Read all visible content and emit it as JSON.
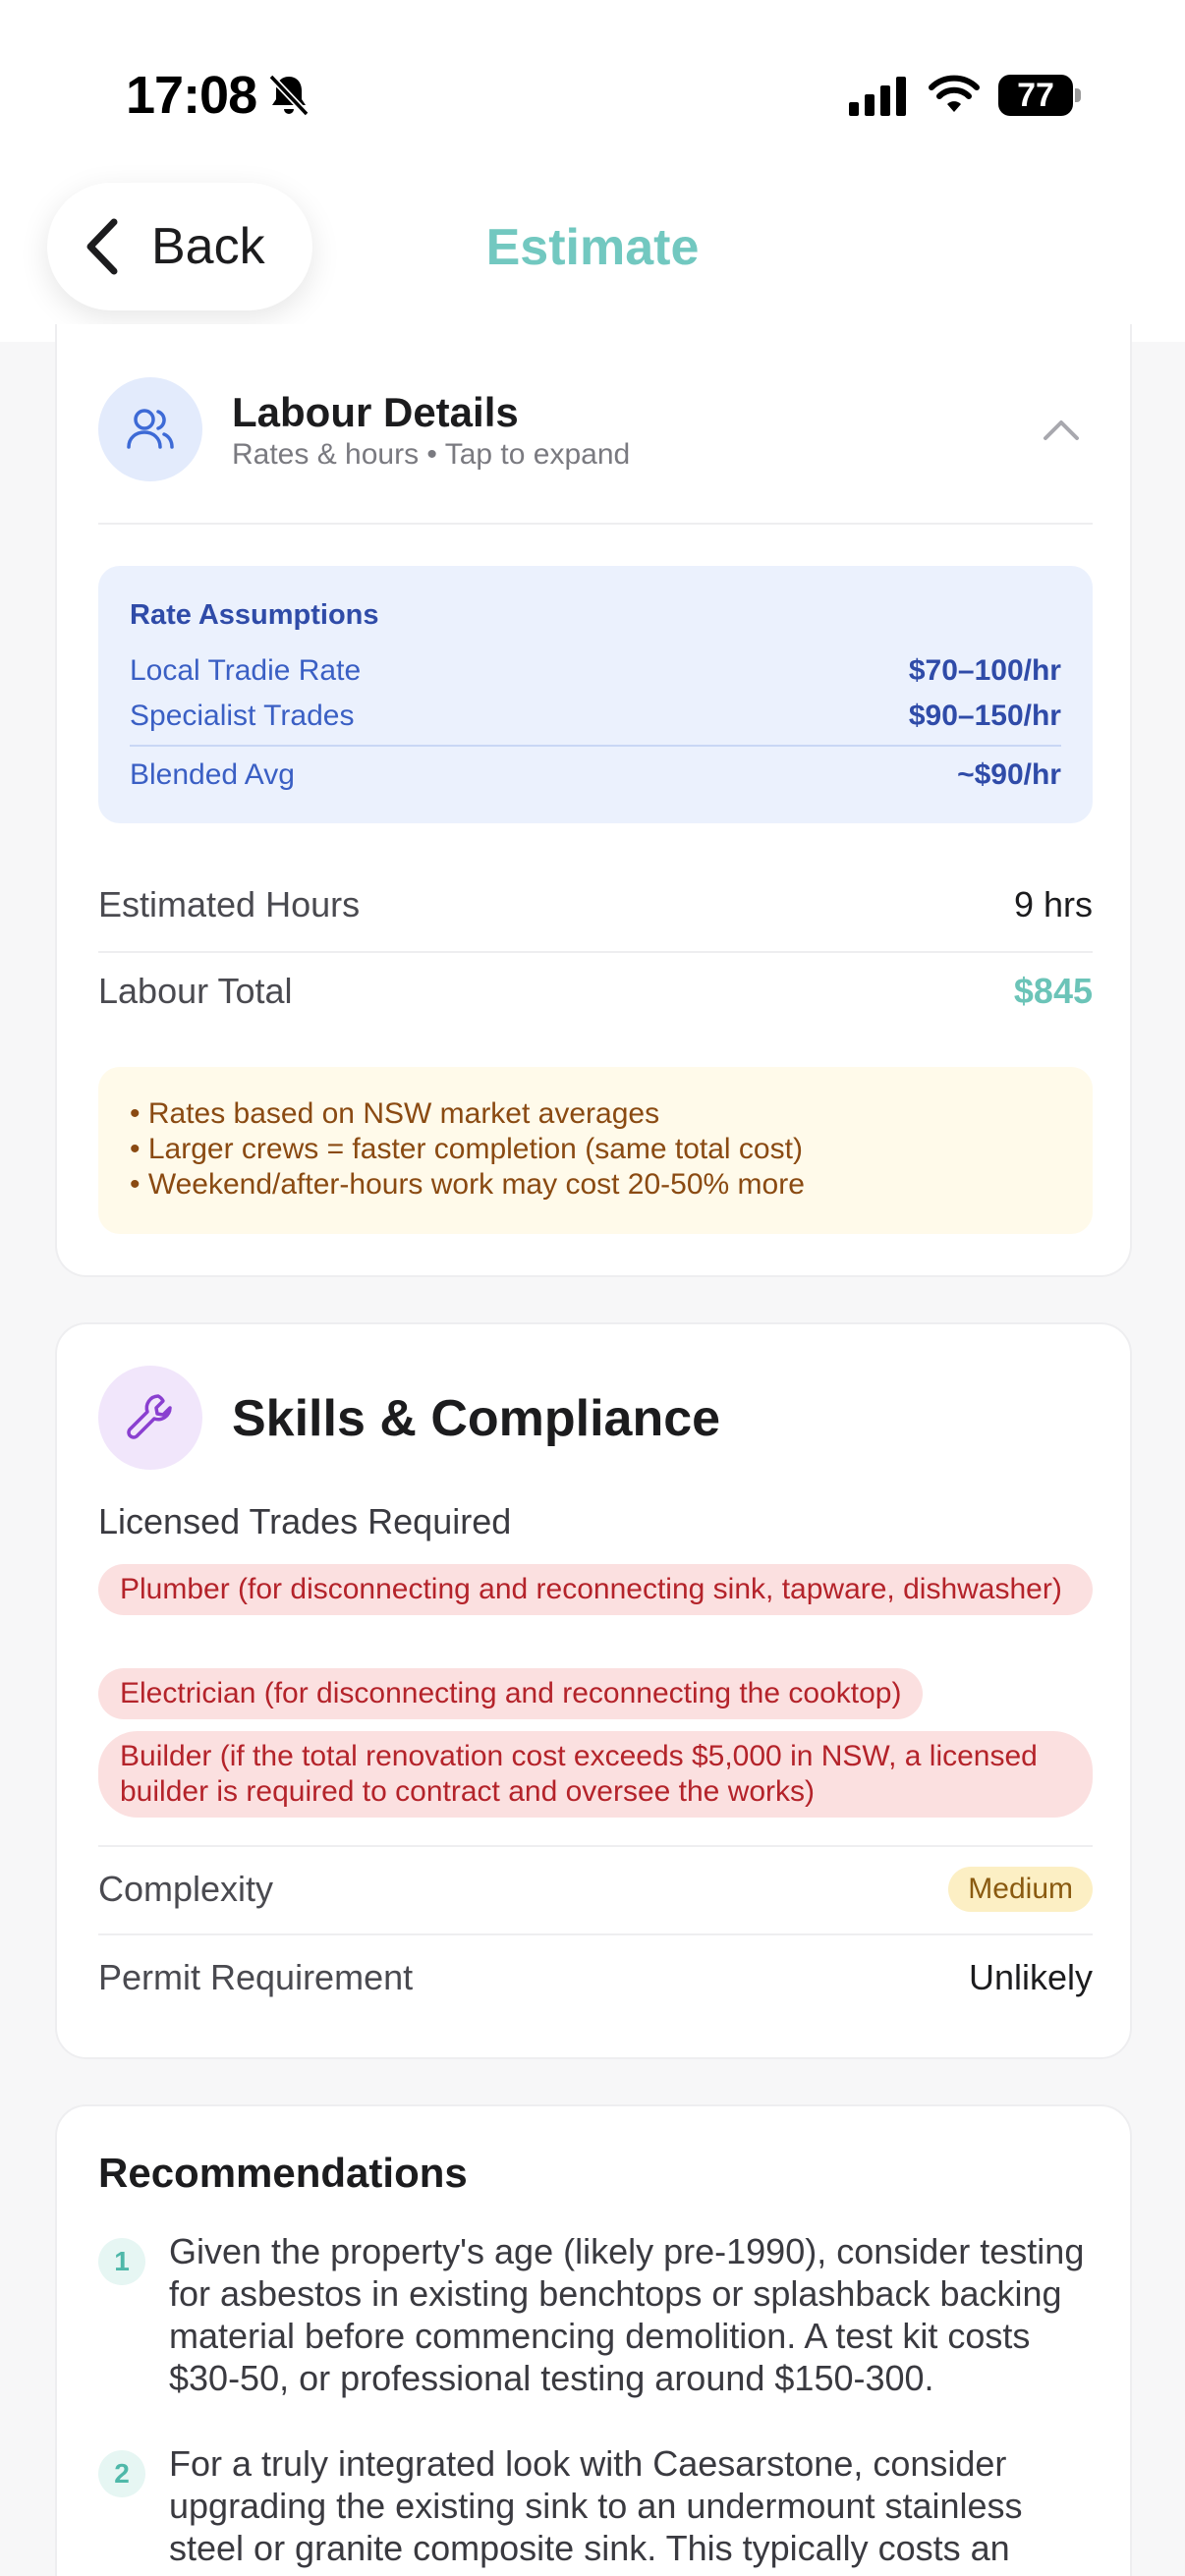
{
  "status_bar": {
    "time": "17:08",
    "battery": "77"
  },
  "header": {
    "back_label": "Back",
    "title": "Estimate"
  },
  "labour": {
    "title": "Labour Details",
    "subtitle": "Rates & hours • Tap to expand",
    "rate_assumptions": {
      "title": "Rate Assumptions",
      "rows": [
        {
          "label": "Local Tradie Rate",
          "value": "$70–100/hr"
        },
        {
          "label": "Specialist Trades",
          "value": "$90–150/hr"
        }
      ],
      "blended": {
        "label": "Blended Avg",
        "value": "~$90/hr"
      }
    },
    "estimated_hours": {
      "label": "Estimated Hours",
      "value": "9 hrs"
    },
    "labour_total": {
      "label": "Labour Total",
      "value": "$845"
    },
    "notes": [
      "• Rates based on NSW market averages",
      "• Larger crews = faster completion (same total cost)",
      "• Weekend/after-hours work may cost 20-50% more"
    ]
  },
  "skills": {
    "title": "Skills & Compliance",
    "licensed_label": "Licensed Trades Required",
    "trades": [
      "Plumber (for disconnecting and reconnecting sink, tapware, dishwasher)",
      "Electrician (for disconnecting and reconnecting the cooktop)",
      "Builder (if the total renovation cost exceeds $5,000 in NSW, a licensed builder is required to contract and oversee the works)"
    ],
    "complexity": {
      "label": "Complexity",
      "value": "Medium"
    },
    "permit": {
      "label": "Permit Requirement",
      "value": "Unlikely"
    }
  },
  "recommendations": {
    "title": "Recommendations",
    "items": [
      {
        "num": "1",
        "text": "Given the property's age (likely pre-1990), consider testing for asbestos in existing benchtops or splashback backing material before commencing demolition. A test kit costs $30-50, or professional testing around $150-300."
      },
      {
        "num": "2",
        "text": "For a truly integrated look with Caesarstone, consider upgrading the existing sink to an undermount stainless steel or granite composite sink. This typically costs an"
      }
    ]
  },
  "colors": {
    "accent": "#72c8c0",
    "labour_total": "#6cc4b8",
    "rate_box_bg": "#ebf1fd",
    "note_bg": "#fffaea",
    "trade_pill_bg": "#fbe0e0",
    "badge_bg": "#fcefc4"
  }
}
